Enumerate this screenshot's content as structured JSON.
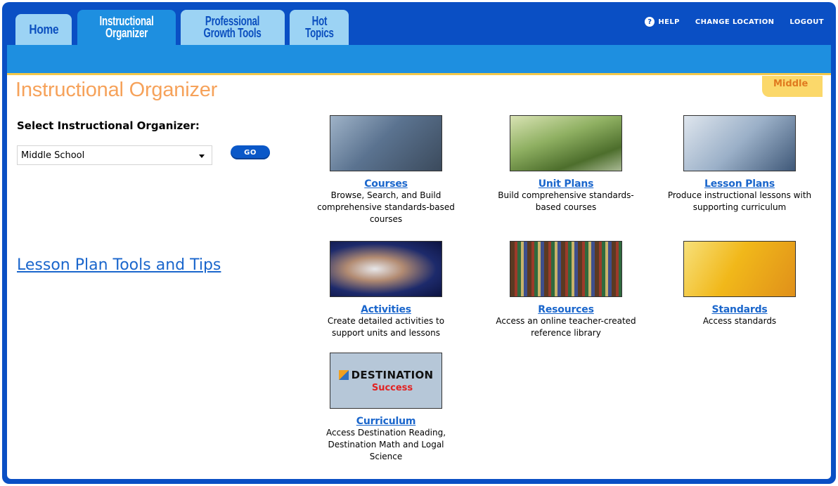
{
  "tabs": [
    {
      "line1": "Home",
      "line2": ""
    },
    {
      "line1": "Instructional",
      "line2": "Organizer"
    },
    {
      "line1": "Professional",
      "line2": "Growth Tools"
    },
    {
      "line1": "Hot",
      "line2": "Topics"
    }
  ],
  "toplinks": {
    "help": "HELP",
    "change_location": "CHANGE LOCATION",
    "logout": "LOGOUT"
  },
  "page": {
    "title": "Instructional Organizer",
    "level_badge": "Middle",
    "select_label": "Select Instructional Organizer:",
    "select_value": "Middle School",
    "go_label": "GO",
    "tips_link": "Lesson Plan Tools and Tips"
  },
  "tiles": [
    {
      "title": "Courses",
      "desc": "Browse, Search, and Build comprehensive standards-based courses",
      "icon": "courses-image"
    },
    {
      "title": "Unit Plans",
      "desc": "Build comprehensive standards-based courses",
      "icon": "unit-plans-image"
    },
    {
      "title": "Lesson Plans",
      "desc": "Produce instructional lessons with supporting curriculum",
      "icon": "lesson-plans-image"
    },
    {
      "title": "Activities",
      "desc": "Create detailed activities to support units and lessons",
      "icon": "activities-image"
    },
    {
      "title": "Resources",
      "desc": "Access an online teacher-created reference library",
      "icon": "resources-image"
    },
    {
      "title": "Standards",
      "desc": "Access standards",
      "icon": "standards-image"
    },
    {
      "title": "Curriculum",
      "desc": "Access Destination Reading, Destination Math and Logal Science",
      "icon": "destination-success-image",
      "thumb_line1": "DESTINATION",
      "thumb_line2": "Success"
    }
  ],
  "colors": {
    "header": "#0a4fc4",
    "subnav": "#1e8fe0",
    "title": "#f6a25a",
    "link": "#1a66cc"
  }
}
